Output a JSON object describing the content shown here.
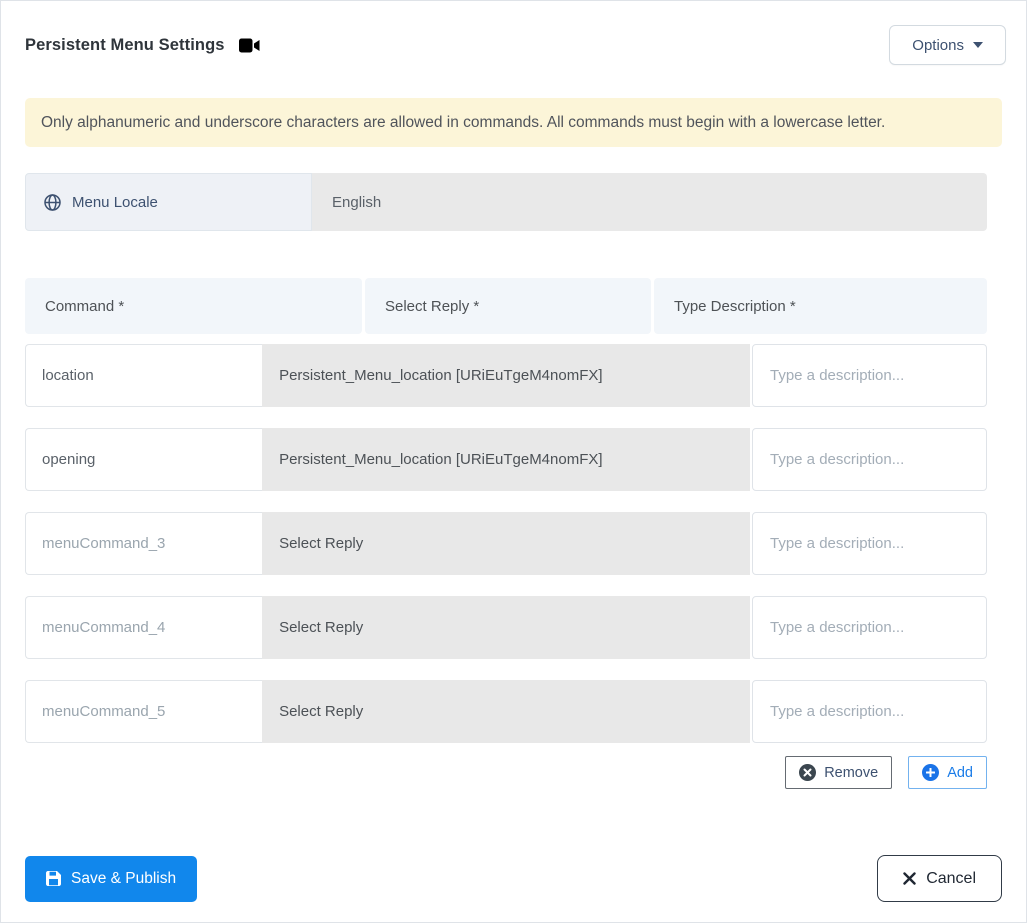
{
  "header": {
    "title": "Persistent Menu Settings",
    "options_label": "Options"
  },
  "alert": {
    "text": "Only alphanumeric and underscore characters are allowed in commands. All commands must begin with a lowercase letter."
  },
  "locale": {
    "label": "Menu Locale",
    "value": "English"
  },
  "table": {
    "headers": [
      "Command *",
      "Select Reply *",
      "Type Description *"
    ],
    "description_placeholder": "Type a description...",
    "rows": [
      {
        "command": "location",
        "command_is_placeholder": false,
        "reply": "Persistent_Menu_location [URiEuTgeM4nomFX]"
      },
      {
        "command": "opening",
        "command_is_placeholder": false,
        "reply": "Persistent_Menu_location [URiEuTgeM4nomFX]"
      },
      {
        "command": "menuCommand_3",
        "command_is_placeholder": true,
        "reply": "Select Reply"
      },
      {
        "command": "menuCommand_4",
        "command_is_placeholder": true,
        "reply": "Select Reply"
      },
      {
        "command": "menuCommand_5",
        "command_is_placeholder": true,
        "reply": "Select Reply"
      }
    ]
  },
  "row_actions": {
    "remove_label": "Remove",
    "add_label": "Add"
  },
  "footer": {
    "save_label": "Save & Publish",
    "cancel_label": "Cancel"
  },
  "colors": {
    "accent_blue": "#1187ec",
    "link_blue": "#1a7ce8",
    "warning_bg": "#fcf5d8",
    "muted_gray_bg": "#e9e9e9",
    "header_cell_bg": "#f2f6fa",
    "locale_cell_bg": "#eef1f6",
    "dark_text": "#3d5170"
  }
}
